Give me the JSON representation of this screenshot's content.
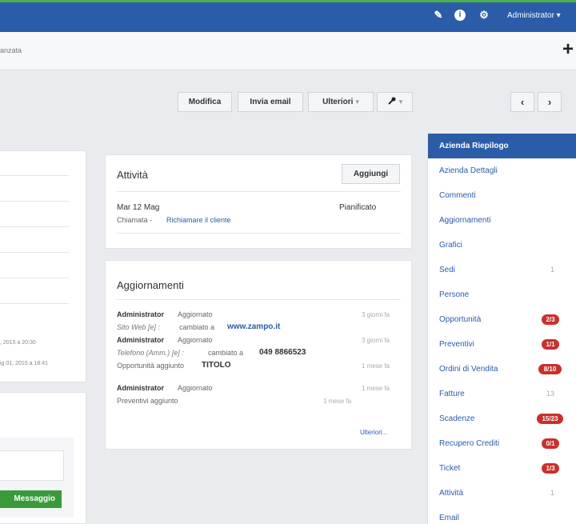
{
  "topbar": {
    "user": "Administrator",
    "icons": [
      "pencil-icon",
      "info-icon",
      "gear-icon"
    ]
  },
  "subbar": {
    "breadcrumb": "anzata",
    "add_label": "+"
  },
  "toolbar": {
    "edit": "Modifica",
    "email": "Invia email",
    "more": "Ulteriori",
    "caret": "▾",
    "tools_icon": "wrench-icon",
    "prev": "‹",
    "next": "›"
  },
  "left": {
    "date1": ", 2015 a 20:30",
    "date2": "ig 01, 2015 a 18:41",
    "message_button": "Messaggio"
  },
  "activity": {
    "title": "Attività",
    "add_button": "Aggiungi",
    "date": "Mar 12 Mag",
    "status": "Pianificato",
    "type": "Chiamata -",
    "subject": "Richiamare il cliente"
  },
  "updates": {
    "title": "Aggiornamenti",
    "entries": [
      {
        "user": "Administrator",
        "action": "Aggiornato",
        "time": "3 giorni fa",
        "field": "Sito Web [e] :",
        "change": "cambiato a",
        "value": "www.zampo.it"
      },
      {
        "user": "Administrator",
        "action": "Aggiornato",
        "time": "3 giorni fa",
        "field": "Telefono (Amm.) [e] :",
        "change": "cambiato a",
        "value": "049 8866523"
      },
      {
        "text": "Opportunità aggiunto",
        "value": "TITOLO",
        "time": "1 mese fa"
      },
      {
        "user": "Administrator",
        "action": "Aggiornato",
        "time": "1 mese fa",
        "text": "Preventivi aggiunto",
        "time2": "1 mese fa"
      }
    ],
    "more_link": "Ulteriori..."
  },
  "sidebar": {
    "items": [
      {
        "label": "Azienda Riepilogo",
        "active": true
      },
      {
        "label": "Azienda Dettagli"
      },
      {
        "label": "Commenti"
      },
      {
        "label": "Aggiornamenti"
      },
      {
        "label": "Grafici"
      },
      {
        "label": "Sedi",
        "count": "1"
      },
      {
        "label": "Persone"
      },
      {
        "label": "Opportunità",
        "badge": "2/3"
      },
      {
        "label": "Preventivi",
        "badge": "1/1"
      },
      {
        "label": "Ordini di Vendita",
        "badge": "8/10"
      },
      {
        "label": "Fatture",
        "count": "13"
      },
      {
        "label": "Scadenze",
        "badge": "15/23"
      },
      {
        "label": "Recupero Crediti",
        "badge": "0/1"
      },
      {
        "label": "Ticket",
        "badge": "1/3"
      },
      {
        "label": "Attività",
        "count": "1"
      },
      {
        "label": "Email"
      }
    ]
  },
  "colors": {
    "topbar": "#2b5ca8",
    "accent_green": "#4caf50",
    "badge_red": "#c9302c",
    "button_green": "#3a9a3a"
  }
}
